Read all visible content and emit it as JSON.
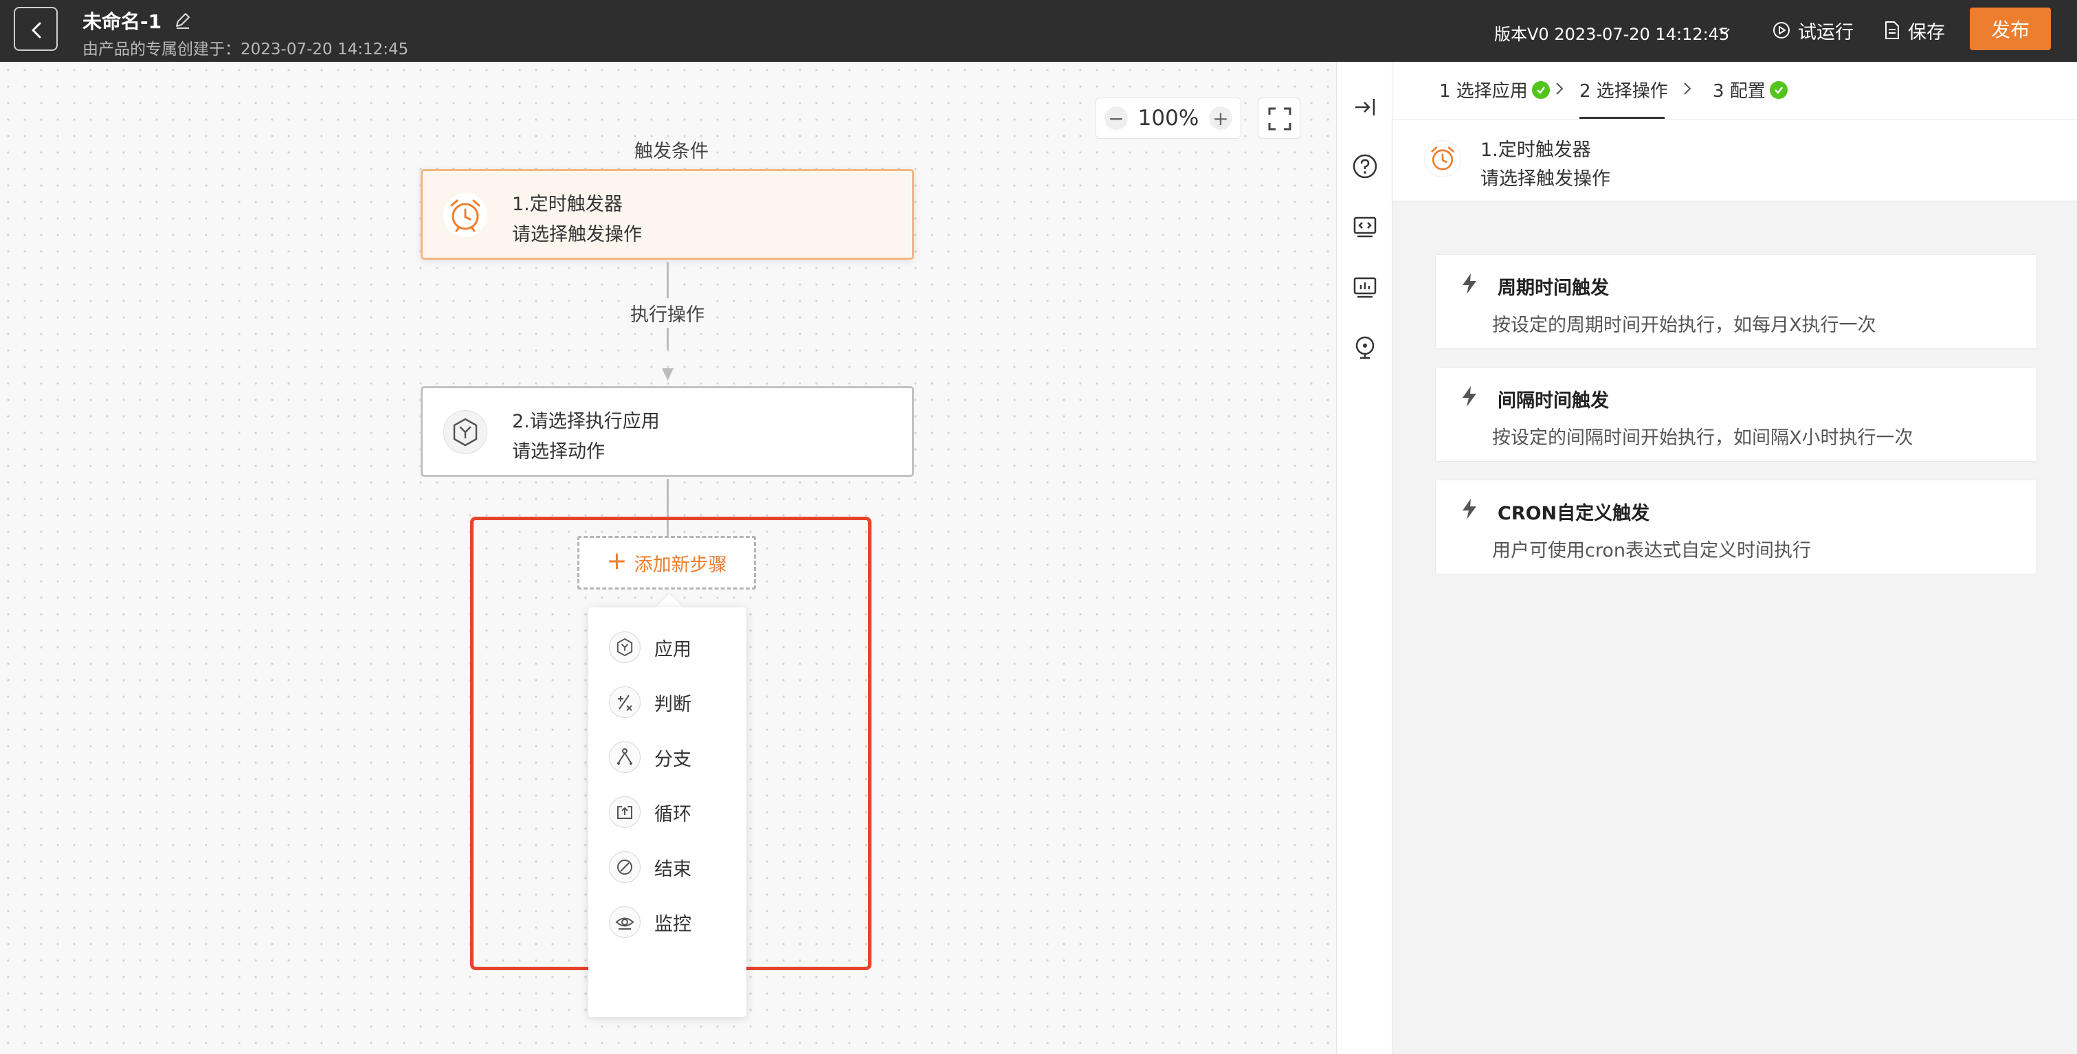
{
  "header": {
    "title": "未命名-1",
    "subtitle": "由产品的专属创建于：2023-07-20 14:12:45",
    "version": "版本V0 2023-07-20 14:12:45",
    "test_run_label": "试运行",
    "save_label": "保存",
    "publish_label": "发布",
    "publish_color": "#ED7D2F"
  },
  "canvas": {
    "zoom": "100%",
    "zoom_out": "−",
    "zoom_in": "+",
    "trigger_section_label": "触发条件",
    "action_section_label": "执行操作",
    "node1": {
      "title": "1.定时触发器",
      "subtitle": "请选择触发操作",
      "icon": "alarm-clock-icon"
    },
    "node2": {
      "title": "2.请选择执行应用",
      "subtitle": "请选择动作",
      "icon": "app-hex-icon"
    },
    "add_step_label": "添加新步骤",
    "menu_items": [
      {
        "label": "应用",
        "icon": "app-hex-icon"
      },
      {
        "label": "判断",
        "icon": "condition-icon"
      },
      {
        "label": "分支",
        "icon": "branch-icon"
      },
      {
        "label": "循环",
        "icon": "loop-icon"
      },
      {
        "label": "结束",
        "icon": "end-icon"
      },
      {
        "label": "监控",
        "icon": "eye-icon"
      }
    ]
  },
  "panel": {
    "steps": [
      {
        "label": "1 选择应用",
        "done": true
      },
      {
        "label": "2 选择操作",
        "done": false
      },
      {
        "label": "3 配置",
        "done": true
      }
    ],
    "trigger": {
      "title": "1.定时触发器",
      "subtitle": "请选择触发操作"
    },
    "options": [
      {
        "title": "周期时间触发",
        "desc": "按设定的周期时间开始执行，如每月X执行一次"
      },
      {
        "title": "间隔时间触发",
        "desc": "按设定的间隔时间开始执行，如间隔X小时执行一次"
      },
      {
        "title": "CRON自定义触发",
        "desc": "用户可使用cron表达式自定义时间执行"
      }
    ]
  }
}
